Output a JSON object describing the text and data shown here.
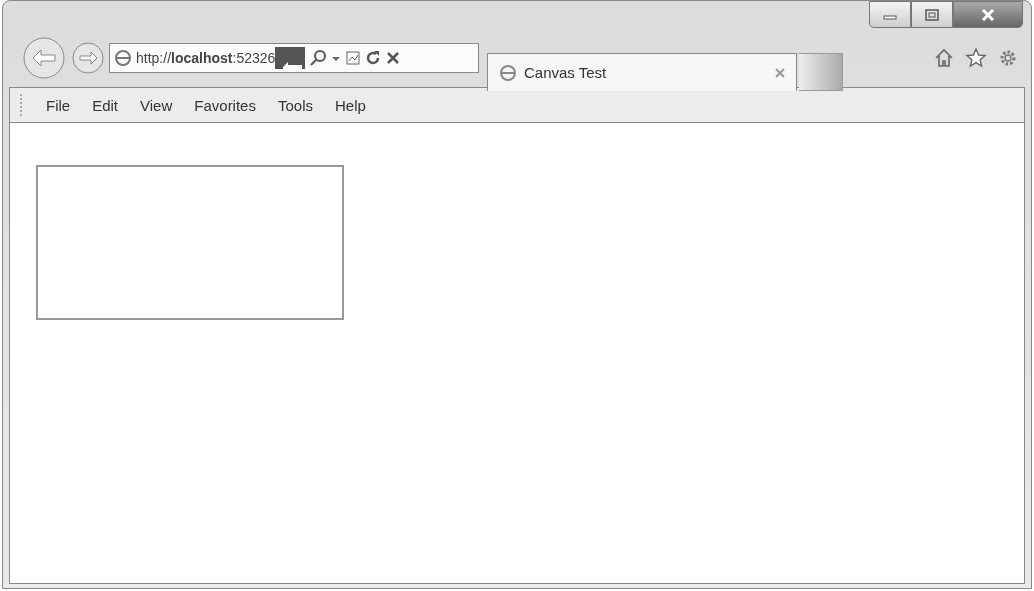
{
  "address_bar": {
    "url": "http://**localhost**:52326"
  },
  "tabs": [
    {
      "label": "Canvas Test",
      "selected": true
    }
  ],
  "menu_bar": {
    "items": [
      "File",
      "Edit",
      "View",
      "Favorites",
      "Tools",
      "Help"
    ]
  }
}
